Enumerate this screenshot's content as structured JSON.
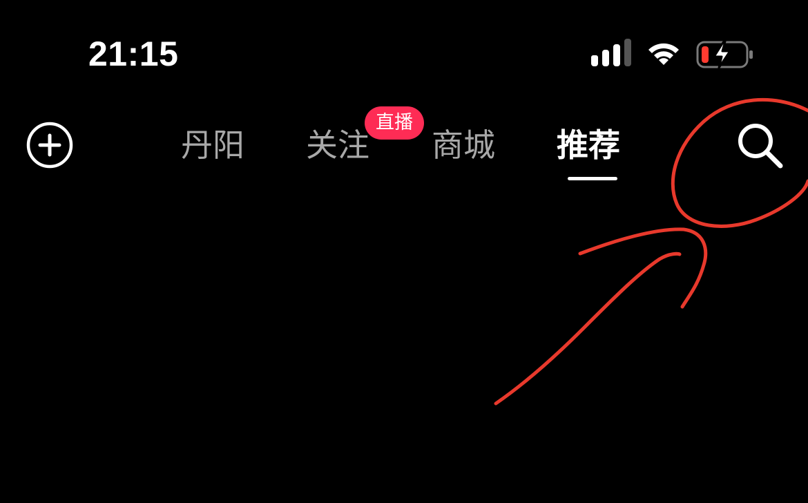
{
  "status_bar": {
    "time": "21:15",
    "signal_icon": "cellular-signal-icon",
    "wifi_icon": "wifi-icon",
    "battery_icon": "battery-low-charging-icon",
    "battery_level": 0.1,
    "battery_charging": true,
    "battery_color": "#ff3b30"
  },
  "top_nav": {
    "add_icon": "plus-circle-icon",
    "tabs": [
      {
        "label": "丹阳",
        "active": false
      },
      {
        "label": "关注",
        "active": false,
        "badge": "直播"
      },
      {
        "label": "商城",
        "active": false
      },
      {
        "label": "推荐",
        "active": true
      }
    ],
    "search_icon": "search-icon"
  },
  "colors": {
    "background": "#000000",
    "active_tab": "#ffffff",
    "inactive_tab": "#a8a8a8",
    "badge": "#fe2c55",
    "annotation": "#e8392c"
  },
  "annotation": {
    "shapes": [
      "circle-around-search",
      "arrow-pointing-to-search"
    ]
  }
}
